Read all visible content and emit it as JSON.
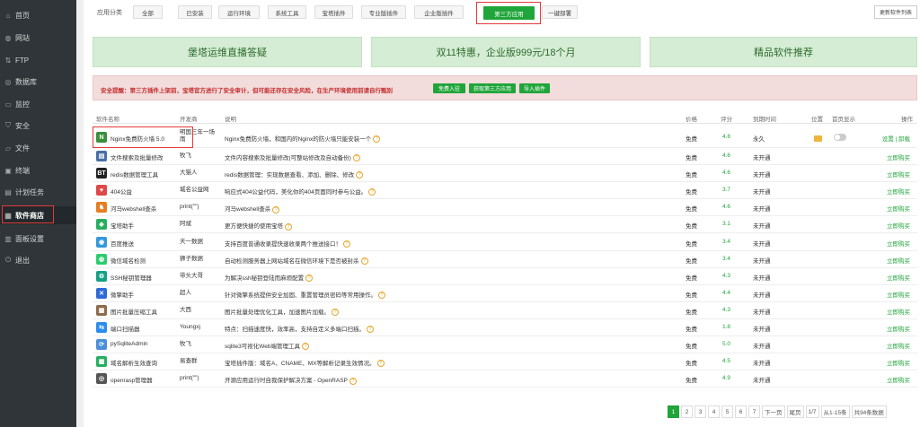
{
  "sidebar": {
    "items": [
      {
        "label": "首页",
        "icon": "home-icon",
        "glyph": "⌂"
      },
      {
        "label": "网站",
        "icon": "globe-icon",
        "glyph": "◍"
      },
      {
        "label": "FTP",
        "icon": "ftp-icon",
        "glyph": "⇅"
      },
      {
        "label": "数据库",
        "icon": "database-icon",
        "glyph": "◎"
      },
      {
        "label": "监控",
        "icon": "monitor-icon",
        "glyph": "▭"
      },
      {
        "label": "安全",
        "icon": "shield-icon",
        "glyph": "⛉"
      },
      {
        "label": "文件",
        "icon": "folder-icon",
        "glyph": "▱"
      },
      {
        "label": "终端",
        "icon": "terminal-icon",
        "glyph": "▣"
      },
      {
        "label": "计划任务",
        "icon": "calendar-icon",
        "glyph": "▤"
      },
      {
        "label": "软件商店",
        "icon": "grid-icon",
        "glyph": "▦"
      },
      {
        "label": "面板设置",
        "icon": "settings-icon",
        "glyph": "▥"
      },
      {
        "label": "退出",
        "icon": "logout-icon",
        "glyph": "⏻"
      }
    ]
  },
  "tabs": {
    "label": "应用分类",
    "items": [
      "全部",
      "已安装",
      "运行环境",
      "系统工具",
      "宝塔插件",
      "专业版插件",
      "企业版插件",
      "第三方应用",
      "一键部署"
    ],
    "active": "第三方应用",
    "update_label": "更新软件列表"
  },
  "banners": [
    "堡塔运维直播答疑",
    "双11特惠，企业版999元/18个月",
    "精品软件推荐"
  ],
  "alert": {
    "text": "安全提醒：第三方插件上架前，宝塔官方进行了安全审计，但可能还存在安全风险，在生产环境使用前请自行甄别",
    "buttons": [
      "免费入驻",
      "获取第三方应用",
      "导入插件"
    ]
  },
  "table": {
    "headers": [
      "软件名称",
      "开发商",
      "说明",
      "价格",
      "评分",
      "到期时间",
      "位置",
      "首页显示",
      "操作"
    ],
    "rows": [
      {
        "name": "Nginx免费防火墙 5.0",
        "dev": "明国三年一场雨",
        "desc": "Nginx免费防火墙，和国内的Nginx的防火墙只能安装一个",
        "price": "免费",
        "score": "4.8",
        "expire": "永久",
        "action": "设置 | 卸载",
        "icon_color": "#3a8f3a",
        "icon_text": "N"
      },
      {
        "name": "文件搜索及批量修改",
        "dev": "牧飞",
        "desc": "文件内容搜索及批量修改(可整站修改及自动备份)",
        "price": "免费",
        "score": "4.6",
        "expire": "未开通",
        "action": "立即购买",
        "icon_color": "#4a6fa5",
        "icon_text": "▤"
      },
      {
        "name": "redis数据管理工具",
        "dev": "大猫人",
        "desc": "redis数据管理：实现数据查看、添加、删除、修改",
        "price": "免费",
        "score": "4.6",
        "expire": "未开通",
        "action": "立即购买",
        "icon_color": "#222222",
        "icon_text": "BT"
      },
      {
        "name": "404公益",
        "dev": "城名公益网",
        "desc": "响应式404公益代码，美化你的404页面同时参与公益。",
        "price": "免费",
        "score": "3.7",
        "expire": "未开通",
        "action": "立即购买",
        "icon_color": "#e04848",
        "icon_text": "♥"
      },
      {
        "name": "河马webshell查杀",
        "dev": "print(\"\")",
        "desc": "河马webshell查杀",
        "price": "免费",
        "score": "4.6",
        "expire": "未开通",
        "action": "立即购买",
        "icon_color": "#e67e22",
        "icon_text": "♞"
      },
      {
        "name": "宝塔助手",
        "dev": "阿斌",
        "desc": "更方便快捷的使用宝塔",
        "price": "免费",
        "score": "3.1",
        "expire": "未开通",
        "action": "立即购买",
        "icon_color": "#27ae60",
        "icon_text": "◈"
      },
      {
        "name": "百度推送",
        "dev": "天一数据",
        "desc": "支持百度普通收录提快速收录两个推送接口！",
        "price": "免费",
        "score": "3.4",
        "expire": "未开通",
        "action": "立即购买",
        "icon_color": "#3498db",
        "icon_text": "◉"
      },
      {
        "name": "微信域名检测",
        "dev": "狮子数据",
        "desc": "自动检测服务器上网站域名在微信环境下是否被封杀",
        "price": "免费",
        "score": "3.4",
        "expire": "未开通",
        "action": "立即购买",
        "icon_color": "#2ecc71",
        "icon_text": "◍"
      },
      {
        "name": "SSH秘钥管理器",
        "dev": "带头大哥",
        "desc": "为解决ssh秘钥登陆而麻烦配置",
        "price": "免费",
        "score": "4.3",
        "expire": "未开通",
        "action": "立即购买",
        "icon_color": "#16a085",
        "icon_text": "⚙"
      },
      {
        "name": "微擎助手",
        "dev": "超人",
        "desc": "针对微擎系统提供安全加固、重置管理员密码等常用操作。",
        "price": "免费",
        "score": "4.4",
        "expire": "未开通",
        "action": "立即购买",
        "icon_color": "#2f6ad8",
        "icon_text": "✕"
      },
      {
        "name": "图片批量压缩工具",
        "dev": "大西",
        "desc": "图片批量处理优化工具，加速图片加载。",
        "price": "免费",
        "score": "4.3",
        "expire": "未开通",
        "action": "立即购买",
        "icon_color": "#8e6c4a",
        "icon_text": "▦"
      },
      {
        "name": "端口扫描器",
        "dev": "Youngxj",
        "desc": "特点：扫描速度快，效率高，支持自定义多端口扫描。",
        "price": "免费",
        "score": "1.8",
        "expire": "未开通",
        "action": "立即购买",
        "icon_color": "#2d8cf0",
        "icon_text": "⇆"
      },
      {
        "name": "pySqliteAdmin",
        "dev": "牧飞",
        "desc": "sqlite3可视化Web端管理工具",
        "price": "免费",
        "score": "5.0",
        "expire": "未开通",
        "action": "立即购买",
        "icon_color": "#4a90d9",
        "icon_text": "⟳"
      },
      {
        "name": "域名解析生效查询",
        "dev": "易查群",
        "desc": "宝塔插件版：域名A、CNAME、MX等解析记录生效情况。",
        "price": "免费",
        "score": "4.5",
        "expire": "未开通",
        "action": "立即购买",
        "icon_color": "#27ae60",
        "icon_text": "▦"
      },
      {
        "name": "openrasp管理器",
        "dev": "print(\"\")",
        "desc": "开源应用运行时自我保护解决方案 - OpenRASP",
        "price": "免费",
        "score": "4.9",
        "expire": "未开通",
        "action": "立即购买",
        "icon_color": "#555555",
        "icon_text": "◎"
      }
    ]
  },
  "pager": {
    "pages": [
      "1",
      "2",
      "3",
      "4",
      "5",
      "6",
      "7"
    ],
    "active": "1",
    "next": "下一页",
    "last": "尾页",
    "page_info": "1/7",
    "range": "从1-15条",
    "total": "共94条数据"
  },
  "colors": {
    "accent": "#20a53a",
    "sidebar": "#2f3539",
    "warn": "#c43030"
  }
}
